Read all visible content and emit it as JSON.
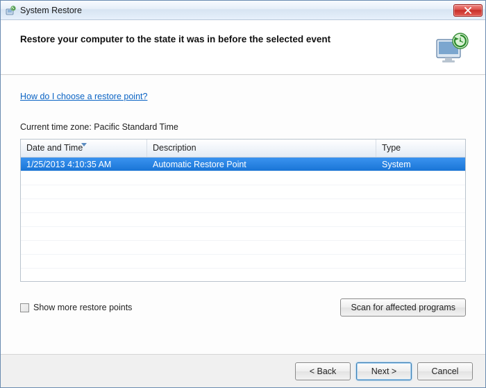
{
  "window": {
    "title": "System Restore"
  },
  "header": {
    "heading": "Restore your computer to the state it was in before the selected event"
  },
  "help_link": "How do I choose a restore point?",
  "timezone_label": "Current time zone: Pacific Standard Time",
  "table": {
    "columns": {
      "date": "Date and Time",
      "desc": "Description",
      "type": "Type"
    },
    "rows": [
      {
        "date": "1/25/2013 4:10:35 AM",
        "desc": "Automatic Restore Point",
        "type": "System",
        "selected": true
      }
    ]
  },
  "show_more": {
    "label": "Show more restore points",
    "checked": false
  },
  "buttons": {
    "scan": "Scan for affected programs",
    "back": "< Back",
    "next": "Next >",
    "cancel": "Cancel"
  }
}
